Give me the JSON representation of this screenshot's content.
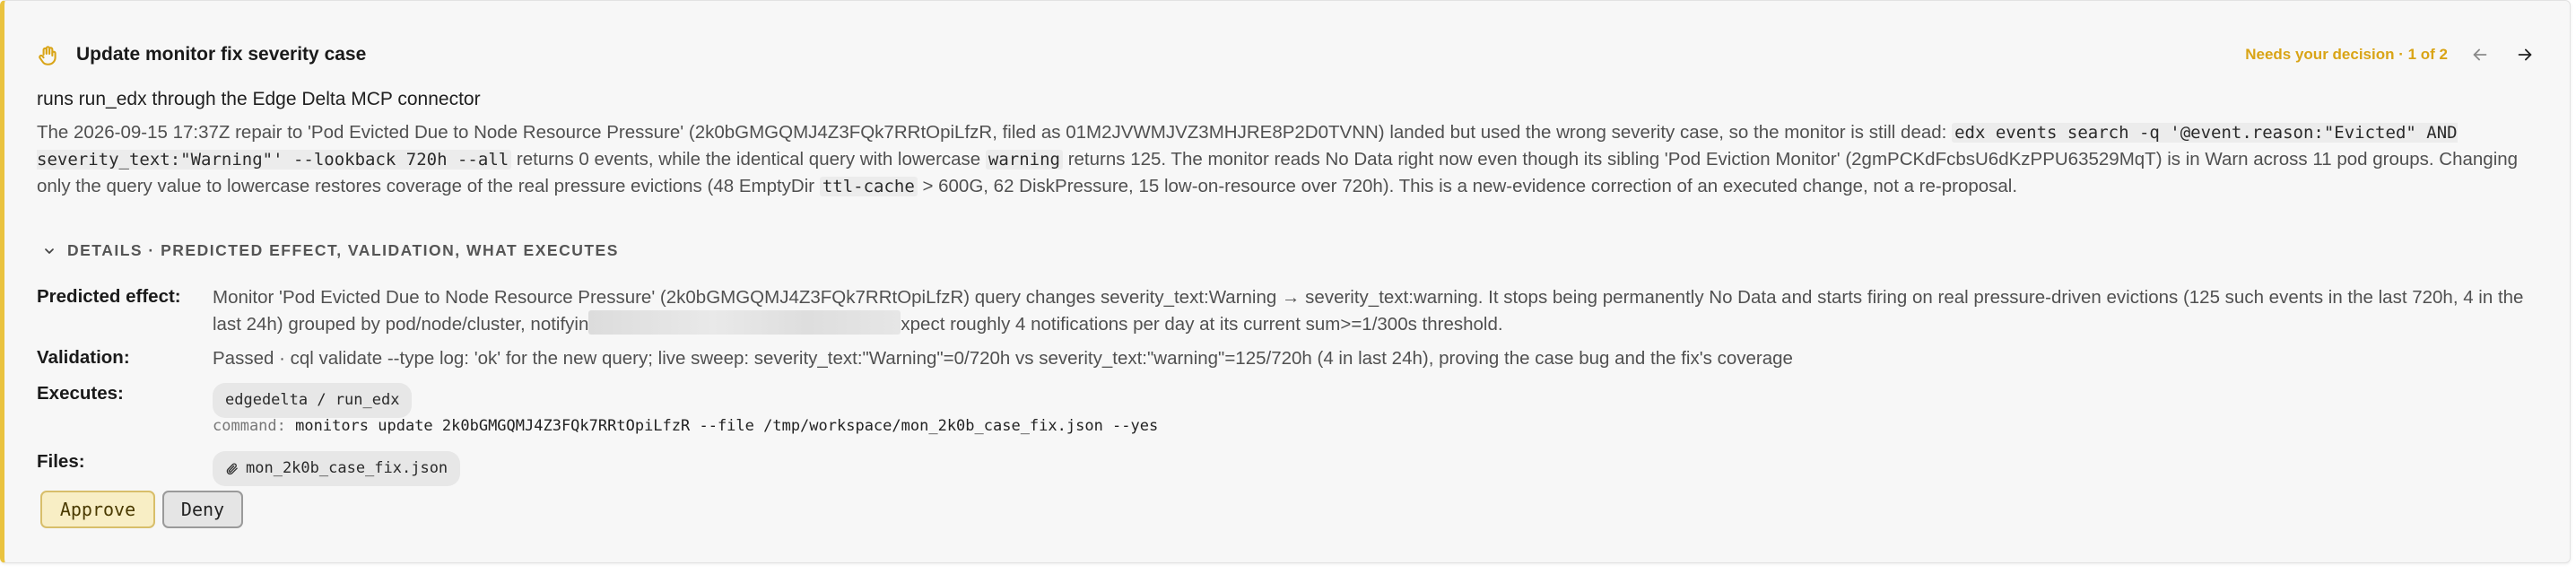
{
  "colors": {
    "accent": "#eac33f",
    "status": "#d9a416",
    "panel": "#f7f7f7"
  },
  "header": {
    "icon": "hand-icon",
    "title": "Update monitor fix severity case",
    "status": "Needs your decision · 1 of 2",
    "prev_icon": "arrow-left-icon",
    "next_icon": "arrow-right-icon"
  },
  "subtitle": "runs run_edx through the Edge Delta MCP connector",
  "description": {
    "t1": "The 2026-09-15 17:37Z repair to 'Pod Evicted Due to Node Resource Pressure' (2k0bGMGQMJ4Z3FQk7RRtOpiLfzR, filed as 01M2JVWMJVZ3MHJRE8P2D0TVNN) landed but used the wrong severity case, so the monitor is still dead: ",
    "c1": "edx events search -q '@event.reason:\"Evicted\" AND severity_text:\"Warning\"' --lookback 720h --all",
    "t2": " returns 0 events, while the identical query with lowercase ",
    "c2": "warning",
    "t3": " returns 125. The monitor reads No Data right now even though its sibling 'Pod Eviction Monitor' (2gmPCKdFcbsU6dKzPPU63529MqT) is in Warn across 11 pod groups. Changing only the query value to lowercase restores coverage of the real pressure evictions (48 EmptyDir ",
    "c3": "ttl-cache",
    "t4": " > 600G, 62 DiskPressure, 15 low-on-resource over 720h). This is a new-evidence correction of an executed change, not a re-proposal."
  },
  "details": {
    "label": "DETAILS · PREDICTED EFFECT, VALIDATION, WHAT EXECUTES",
    "toggle_icon": "chevron-down-icon"
  },
  "predicted": {
    "label": "Predicted effect:",
    "text_a": "Monitor 'Pod Evicted Due to Node Resource Pressure' (2k0bGMGQMJ4Z3FQk7RRtOpiLfzR) query changes severity_text:Warning → severity_text:warning. It stops being permanently No Data and starts firing on real pressure-driven evictions (125 such events in the last 720h, 4 in the last 24h) grouped by pod/node/cluster, notifyin",
    "text_b": "xpect roughly 4 notifications per day at its current sum>=1/300s threshold."
  },
  "validation": {
    "label": "Validation:",
    "text": "Passed · cql validate --type log: 'ok' for the new query; live sweep: severity_text:\"Warning\"=0/720h vs severity_text:\"warning\"=125/720h (4 in last 24h), proving the case bug and the fix's coverage"
  },
  "executes": {
    "label": "Executes:",
    "tool": "edgedelta / run_edx",
    "command_key": "command:",
    "command": "monitors update 2k0bGMGQMJ4Z3FQk7RRtOpiLfzR --file /tmp/workspace/mon_2k0b_case_fix.json --yes"
  },
  "files": {
    "label": "Files:",
    "icon": "paperclip-icon",
    "name": "mon_2k0b_case_fix.json"
  },
  "actions": {
    "approve": "Approve",
    "deny": "Deny"
  }
}
